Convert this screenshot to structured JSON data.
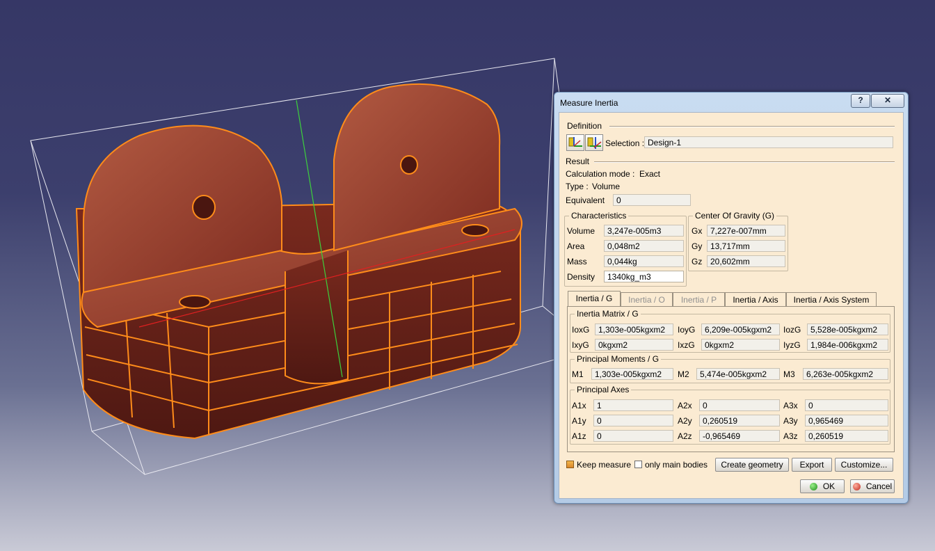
{
  "dialog": {
    "title": "Measure Inertia",
    "help_label": "?",
    "close_label": "✕"
  },
  "definition": {
    "heading": "Definition",
    "selection_label": "Selection :",
    "selection_value": "Design-1"
  },
  "result": {
    "heading": "Result",
    "calc_mode_label": "Calculation mode :",
    "calc_mode_value": "Exact",
    "type_label": "Type :",
    "type_value": "Volume",
    "equivalent_label": "Equivalent",
    "equivalent_value": "0"
  },
  "characteristics": {
    "title": "Characteristics",
    "rows": [
      {
        "label": "Volume",
        "value": "3,247e-005m3"
      },
      {
        "label": "Area",
        "value": "0,048m2"
      },
      {
        "label": "Mass",
        "value": "0,044kg"
      },
      {
        "label": "Density",
        "value": "1340kg_m3"
      }
    ]
  },
  "cog": {
    "title": "Center Of Gravity (G)",
    "rows": [
      {
        "label": "Gx",
        "value": "7,227e-007mm"
      },
      {
        "label": "Gy",
        "value": "13,717mm"
      },
      {
        "label": "Gz",
        "value": "20,602mm"
      }
    ]
  },
  "tabs": [
    {
      "label": "Inertia / G",
      "state": "active"
    },
    {
      "label": "Inertia / O",
      "state": "disabled"
    },
    {
      "label": "Inertia / P",
      "state": "disabled"
    },
    {
      "label": "Inertia / Axis",
      "state": "normal"
    },
    {
      "label": "Inertia / Axis System",
      "state": "normal"
    }
  ],
  "inertia_matrix": {
    "title": "Inertia Matrix / G",
    "row1": [
      {
        "label": "IoxG",
        "value": "1,303e-005kgxm2"
      },
      {
        "label": "IoyG",
        "value": "6,209e-005kgxm2"
      },
      {
        "label": "IozG",
        "value": "5,528e-005kgxm2"
      }
    ],
    "row2": [
      {
        "label": "IxyG",
        "value": "0kgxm2"
      },
      {
        "label": "IxzG",
        "value": "0kgxm2"
      },
      {
        "label": "IyzG",
        "value": "1,984e-006kgxm2"
      }
    ]
  },
  "principal_moments": {
    "title": "Principal Moments / G",
    "row": [
      {
        "label": "M1",
        "value": "1,303e-005kgxm2"
      },
      {
        "label": "M2",
        "value": "5,474e-005kgxm2"
      },
      {
        "label": "M3",
        "value": "6,263e-005kgxm2"
      }
    ]
  },
  "principal_axes": {
    "title": "Principal Axes",
    "rows": [
      [
        {
          "label": "A1x",
          "value": "1"
        },
        {
          "label": "A2x",
          "value": "0"
        },
        {
          "label": "A3x",
          "value": "0"
        }
      ],
      [
        {
          "label": "A1y",
          "value": "0"
        },
        {
          "label": "A2y",
          "value": "0,260519"
        },
        {
          "label": "A3y",
          "value": "0,965469"
        }
      ],
      [
        {
          "label": "A1z",
          "value": "0"
        },
        {
          "label": "A2z",
          "value": "-0,965469"
        },
        {
          "label": "A3z",
          "value": "0,260519"
        }
      ]
    ]
  },
  "footer": {
    "keep_measure_label": "Keep measure",
    "keep_measure_checked": true,
    "only_main_bodies_label": "only main bodies",
    "only_main_bodies_checked": false,
    "create_geometry_label": "Create geometry",
    "export_label": "Export",
    "customize_label": "Customize...",
    "ok_label": "OK",
    "cancel_label": "Cancel"
  },
  "colors": {
    "part_fill": "#9c3d2a",
    "part_edge": "#ff8c1a",
    "background_top": "#363766",
    "dialog_client": "#fbebd2"
  }
}
